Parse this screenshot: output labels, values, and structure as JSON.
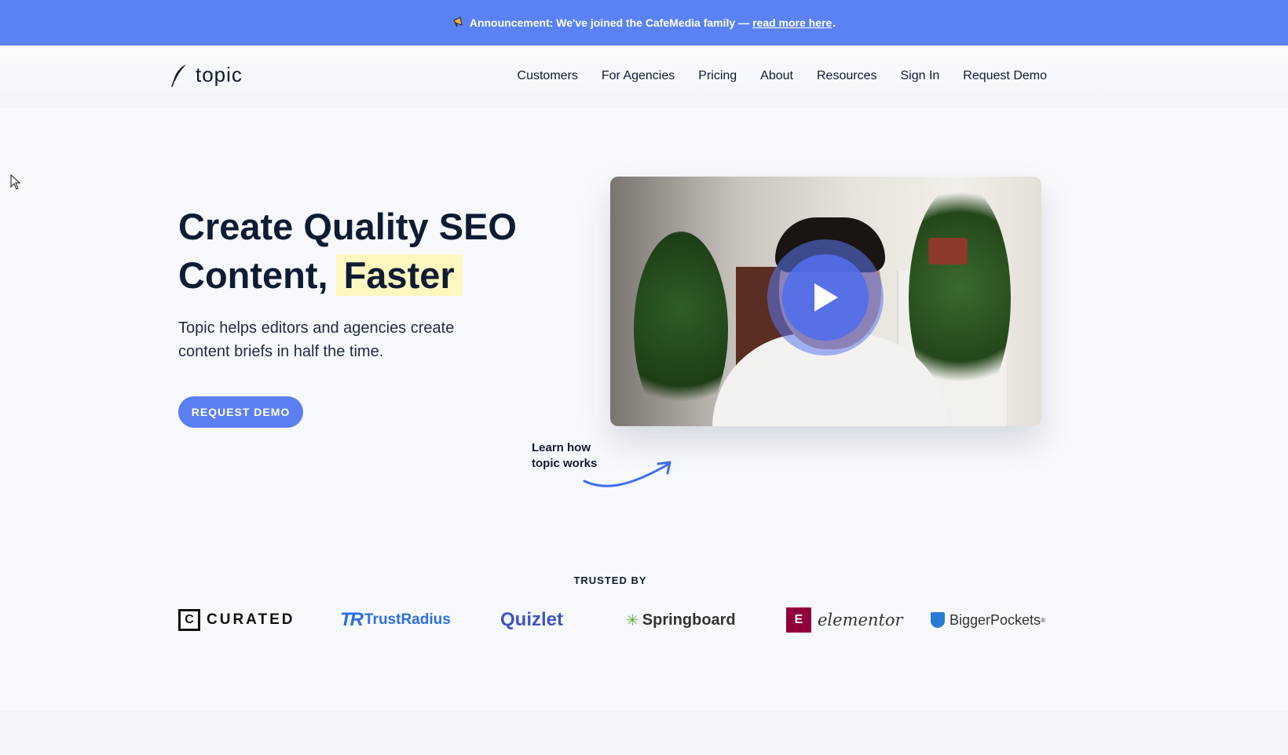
{
  "announcement": {
    "text": "Announcement: We've joined the CafeMedia family —",
    "link_text": "read more here",
    "suffix": ".",
    "icon": "megaphone-icon"
  },
  "header": {
    "logo_text": "topic",
    "logo_icon": "feather-icon",
    "nav": [
      "Customers",
      "For Agencies",
      "Pricing",
      "About",
      "Resources",
      "Sign In",
      "Request Demo"
    ]
  },
  "hero": {
    "title_line1": "Create Quality SEO",
    "title_line2_a": "Content,",
    "title_highlight": "Faster",
    "subtitle": "Topic helps editors and agencies create content briefs in half the time.",
    "cta_label": "REQUEST DEMO",
    "video_icon": "play-icon",
    "learn_line1": "Learn how",
    "learn_line2": "topic works"
  },
  "trusted": {
    "heading": "TRUSTED BY",
    "logos": {
      "curated_mark": "C",
      "curated": "CURATED",
      "trustradius_mark": "TR",
      "trustradius": "TrustRadius",
      "quizlet": "Quizlet",
      "springboard": "Springboard",
      "elementor_mark": "E",
      "elementor": "elementor",
      "biggerpockets": "BiggerPockets",
      "biggerpockets_reg": "®"
    }
  },
  "colors": {
    "announce_bg": "#5b82f5",
    "accent": "#5b7ef3",
    "highlight": "#fdf7c0",
    "text": "#0f1b33"
  }
}
